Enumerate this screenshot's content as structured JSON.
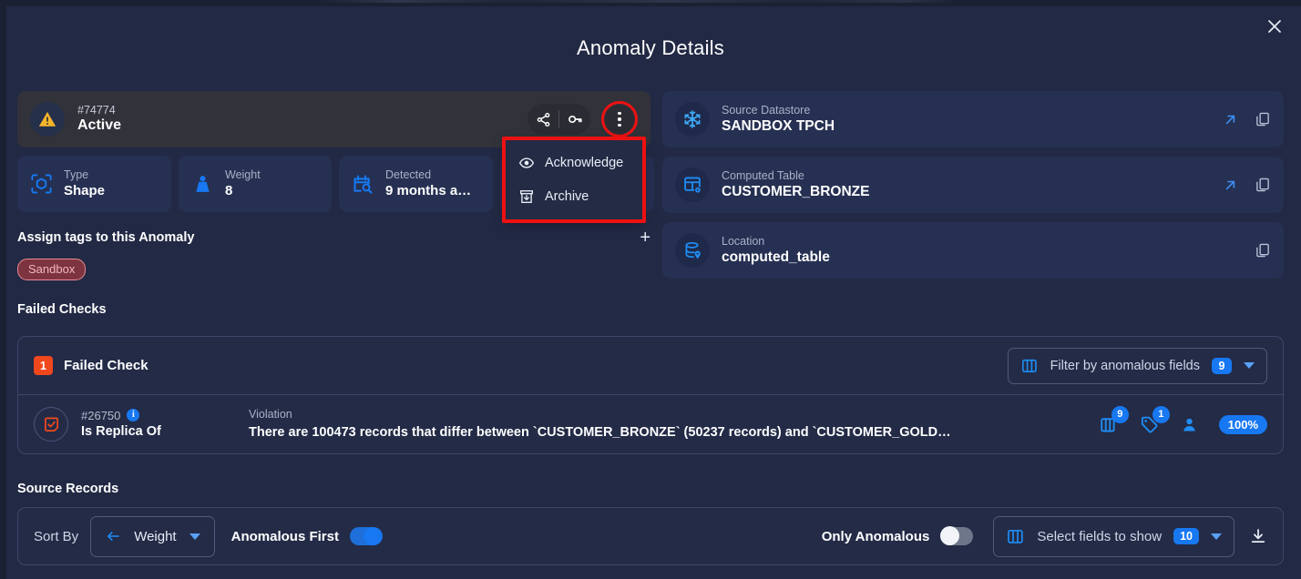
{
  "header": {
    "title": "Anomaly Details",
    "close_label": "✕"
  },
  "status": {
    "icon": "warning-triangle-icon",
    "id": "#74774",
    "state": "Active",
    "actions": {
      "share_label": "share-icon",
      "key_label": "key-icon",
      "more_label": "kebab-menu-icon"
    }
  },
  "menu": {
    "items": [
      {
        "label": "Acknowledge",
        "icon": "eye-icon"
      },
      {
        "label": "Archive",
        "icon": "archive-icon"
      }
    ]
  },
  "info_cards": [
    {
      "label": "Type",
      "value": "Shape",
      "icon": "shape-cube-icon"
    },
    {
      "label": "Weight",
      "value": "8",
      "icon": "weight-icon"
    },
    {
      "label": "Detected",
      "value": "9 months a…",
      "icon": "calendar-search-icon"
    },
    {
      "label": "",
      "value": "",
      "icon": "hidden-icon"
    }
  ],
  "tags": {
    "title": "Assign tags to this Anomaly",
    "add_label": "+",
    "chips": [
      "Sandbox"
    ]
  },
  "right_cards": [
    {
      "label": "Source Datastore",
      "value": "SANDBOX TPCH",
      "icon": "snowflake-icon",
      "has_open": true,
      "has_copy": true
    },
    {
      "label": "Computed Table",
      "value": "CUSTOMER_BRONZE",
      "icon": "computed-table-icon",
      "has_open": true,
      "has_copy": true
    },
    {
      "label": "Location",
      "value": "computed_table",
      "icon": "database-location-icon",
      "has_open": false,
      "has_copy": true
    }
  ],
  "failed_checks": {
    "section_title": "Failed Checks",
    "count": "1",
    "header_label": "Failed Check",
    "filter": {
      "text": "Filter by anomalous fields",
      "count": "9",
      "icon": "columns-icon"
    },
    "row": {
      "icon": "check-square-icon",
      "id": "#26750",
      "info_badge": "i",
      "name": "Is Replica Of",
      "violation_label": "Violation",
      "violation_text": "There are 100473 records that differ between `CUSTOMER_BRONZE` (50237 records) and `CUSTOMER_GOLD…",
      "stats": {
        "fields_icon": "columns-icon",
        "fields_count": "9",
        "tags_icon": "tag-icon",
        "tags_count": "1",
        "user_icon": "user-icon",
        "percent": "100%"
      }
    }
  },
  "source_records": {
    "section_title": "Source Records",
    "sort_by_label": "Sort By",
    "sort_direction_icon": "arrow-left-icon",
    "sort_value": "Weight",
    "anomalous_first_label": "Anomalous First",
    "anomalous_first_on": true,
    "only_anomalous_label": "Only Anomalous",
    "only_anomalous_on": false,
    "fields_select_text": "Select fields to show",
    "fields_select_count": "10",
    "fields_select_icon": "columns-icon",
    "download_icon": "download-icon"
  },
  "colors": {
    "accent_blue": "#1778f2",
    "orange": "#f1471d",
    "warning_yellow": "#f5b52b",
    "highlight_red": "#ee1111",
    "tag_red": "#7d3440"
  }
}
